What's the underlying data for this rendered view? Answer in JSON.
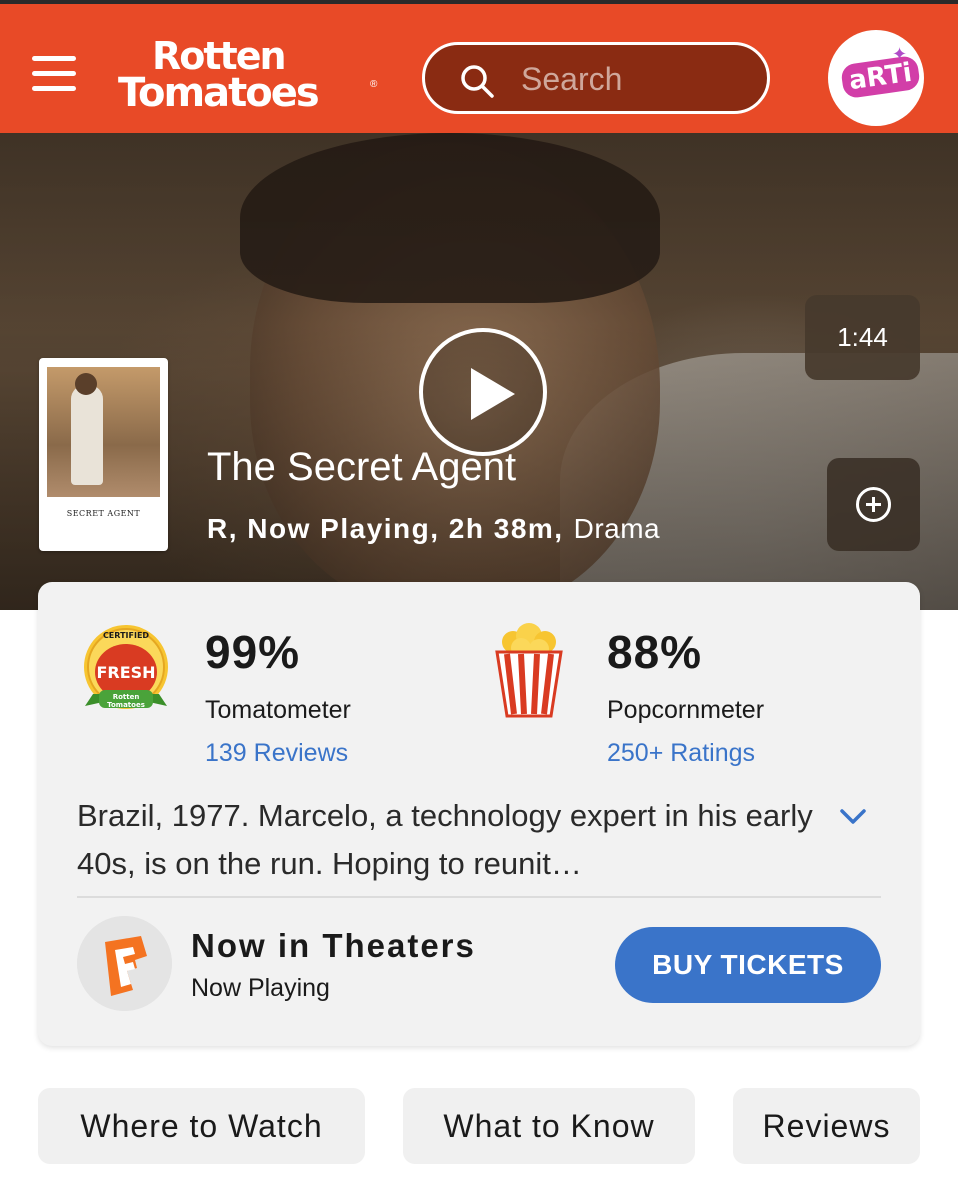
{
  "header": {
    "logo_line1": "Rotten",
    "logo_line2": "Tomatoes",
    "logo_mark": "®",
    "search_placeholder": "Search",
    "avatar_text": "aRTi",
    "colors": {
      "brand": "#e84a27",
      "link": "#3a74c9"
    },
    "icons": [
      "menu-icon",
      "search-icon",
      "avatar-icon"
    ]
  },
  "hero": {
    "duration": "1:44",
    "title": "The Secret Agent",
    "meta_facts": "R, Now Playing, 2h 38m,",
    "genre": "Drama",
    "poster_title": "SECRET AGENT",
    "icons": [
      "play-icon",
      "add-circle-icon"
    ]
  },
  "scores": {
    "tomatometer": {
      "value": "99%",
      "label": "Tomatometer",
      "link": "139 Reviews",
      "badge_top": "CERTIFIED",
      "badge_mid": "FRESH",
      "badge_bot1": "Rotten",
      "badge_bot2": "Tomatoes"
    },
    "popcornmeter": {
      "value": "88%",
      "label": "Popcornmeter",
      "link": "250+ Ratings"
    }
  },
  "synopsis": "Brazil, 1977. Marcelo, a technology expert in his early 40s, is on the run. Hoping to reunit…",
  "theaters": {
    "title": "Now in Theaters",
    "subtitle": "Now Playing",
    "button": "BUY TICKETS",
    "icons": [
      "fandango-icon",
      "chevron-down-icon"
    ]
  },
  "tabs": [
    {
      "label": "Where to Watch"
    },
    {
      "label": "What to Know"
    },
    {
      "label": "Reviews"
    }
  ]
}
